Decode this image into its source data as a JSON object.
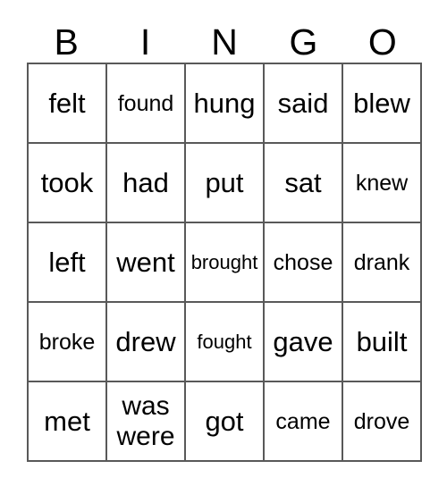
{
  "header": {
    "letters": [
      "B",
      "I",
      "N",
      "G",
      "O"
    ]
  },
  "grid": {
    "rows": [
      {
        "cells": [
          {
            "text": "felt",
            "size": "normal"
          },
          {
            "text": "found",
            "size": "sm"
          },
          {
            "text": "hung",
            "size": "normal"
          },
          {
            "text": "said",
            "size": "normal"
          },
          {
            "text": "blew",
            "size": "normal"
          }
        ]
      },
      {
        "cells": [
          {
            "text": "took",
            "size": "normal"
          },
          {
            "text": "had",
            "size": "normal"
          },
          {
            "text": "put",
            "size": "normal"
          },
          {
            "text": "sat",
            "size": "normal"
          },
          {
            "text": "knew",
            "size": "sm"
          }
        ]
      },
      {
        "cells": [
          {
            "text": "left",
            "size": "normal"
          },
          {
            "text": "went",
            "size": "normal"
          },
          {
            "text": "brought",
            "size": "xs"
          },
          {
            "text": "chose",
            "size": "sm"
          },
          {
            "text": "drank",
            "size": "sm"
          }
        ]
      },
      {
        "cells": [
          {
            "text": "broke",
            "size": "sm"
          },
          {
            "text": "drew",
            "size": "normal"
          },
          {
            "text": "fought",
            "size": "xs"
          },
          {
            "text": "gave",
            "size": "normal"
          },
          {
            "text": "built",
            "size": "normal"
          }
        ]
      },
      {
        "cells": [
          {
            "text": "met",
            "size": "normal"
          },
          {
            "text": "was\nwere",
            "size": "two-line"
          },
          {
            "text": "got",
            "size": "normal"
          },
          {
            "text": "came",
            "size": "sm"
          },
          {
            "text": "drove",
            "size": "sm"
          }
        ]
      }
    ]
  },
  "colors": {
    "background": "#ffffff",
    "text": "#000000",
    "border": "#595959"
  }
}
